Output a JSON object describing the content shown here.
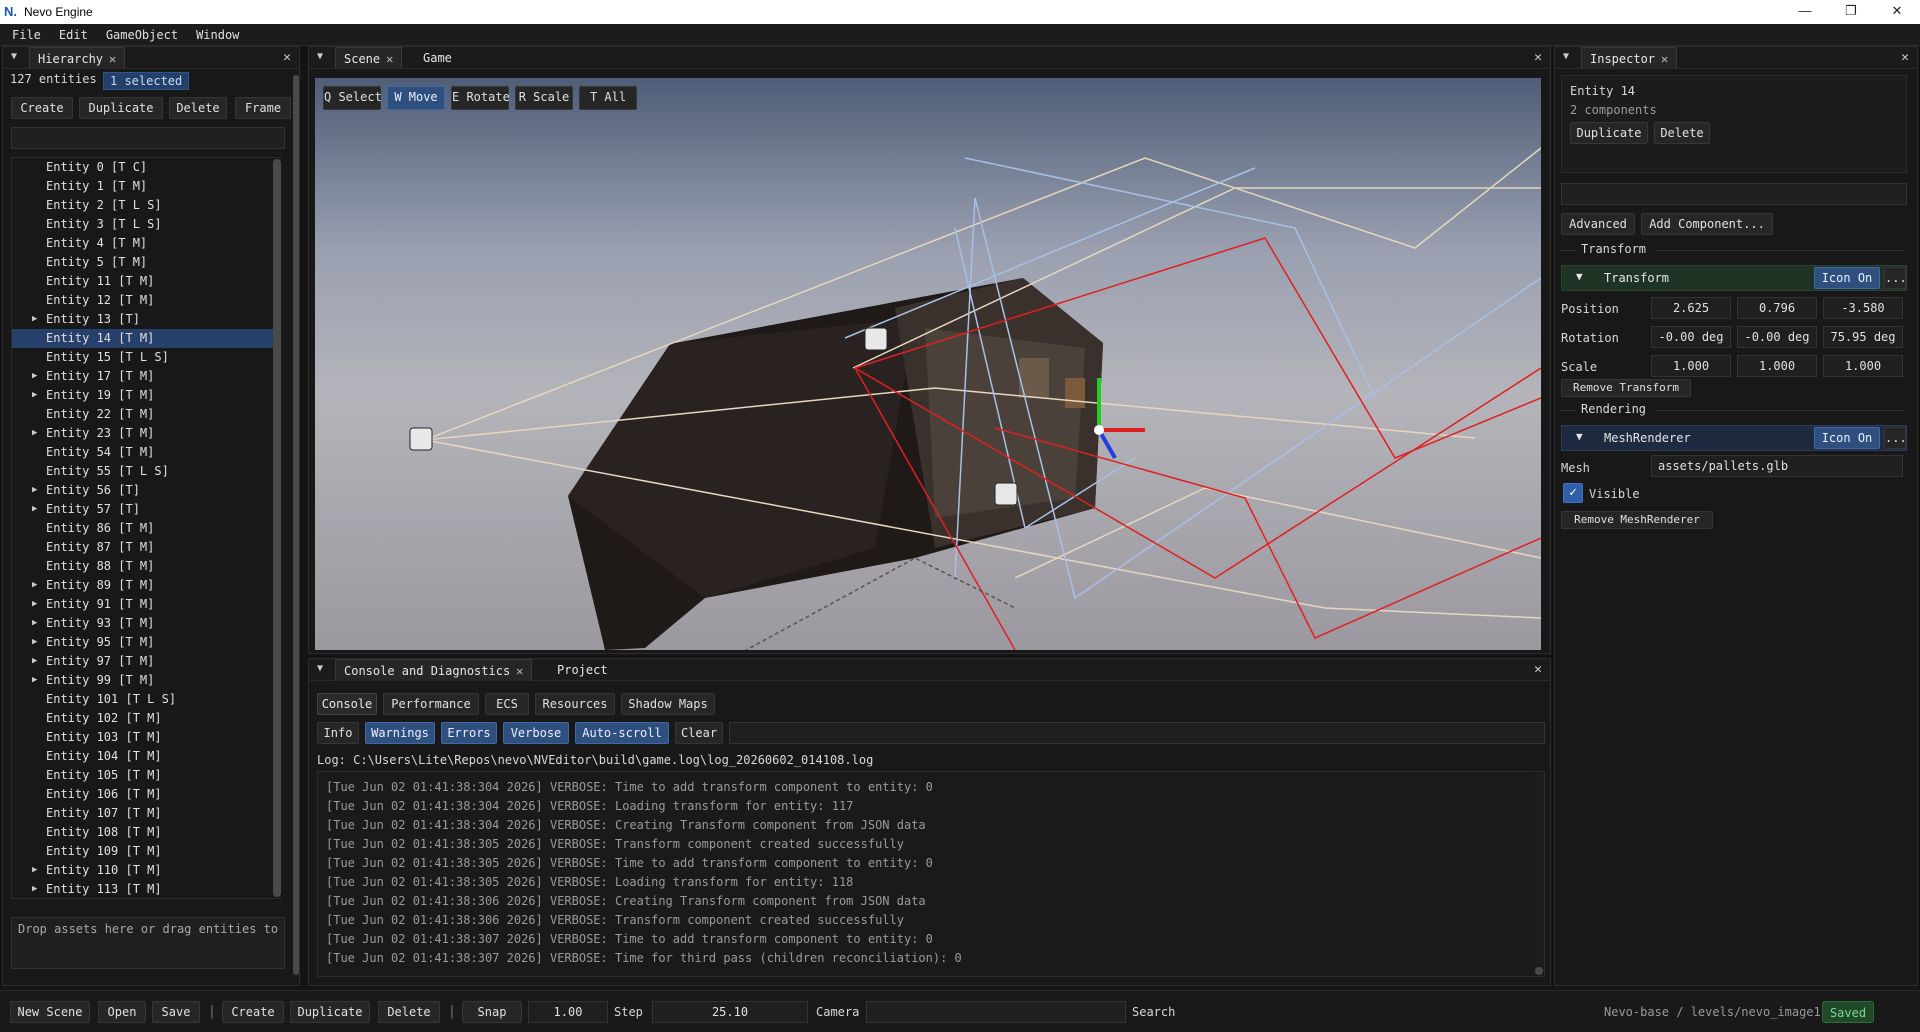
{
  "window": {
    "title": "Nevo Engine",
    "logo": "N.",
    "minimize": "—",
    "maximize": "❐",
    "close": "✕"
  },
  "menu": [
    "File",
    "Edit",
    "GameObject",
    "Window"
  ],
  "hierarchy": {
    "tab": "Hierarchy",
    "count": "127 entities",
    "selected_badge": "1 selected",
    "buttons": [
      "Create",
      "Duplicate",
      "Delete",
      "Frame"
    ],
    "filter_value": "",
    "entities": [
      {
        "label": "Entity 0 [T C]",
        "expandable": false,
        "selected": false
      },
      {
        "label": "Entity 1 [T M]",
        "expandable": false,
        "selected": false
      },
      {
        "label": "Entity 2 [T L S]",
        "expandable": false,
        "selected": false
      },
      {
        "label": "Entity 3 [T L S]",
        "expandable": false,
        "selected": false
      },
      {
        "label": "Entity 4 [T M]",
        "expandable": false,
        "selected": false
      },
      {
        "label": "Entity 5 [T M]",
        "expandable": false,
        "selected": false
      },
      {
        "label": "Entity 11 [T M]",
        "expandable": false,
        "selected": false
      },
      {
        "label": "Entity 12 [T M]",
        "expandable": false,
        "selected": false
      },
      {
        "label": "Entity 13 [T]",
        "expandable": true,
        "selected": false
      },
      {
        "label": "Entity 14 [T M]",
        "expandable": false,
        "selected": true
      },
      {
        "label": "Entity 15 [T L S]",
        "expandable": false,
        "selected": false
      },
      {
        "label": "Entity 17 [T M]",
        "expandable": true,
        "selected": false
      },
      {
        "label": "Entity 19 [T M]",
        "expandable": true,
        "selected": false
      },
      {
        "label": "Entity 22 [T M]",
        "expandable": false,
        "selected": false
      },
      {
        "label": "Entity 23 [T M]",
        "expandable": true,
        "selected": false
      },
      {
        "label": "Entity 54 [T M]",
        "expandable": false,
        "selected": false
      },
      {
        "label": "Entity 55 [T L S]",
        "expandable": false,
        "selected": false
      },
      {
        "label": "Entity 56 [T]",
        "expandable": true,
        "selected": false
      },
      {
        "label": "Entity 57 [T]",
        "expandable": true,
        "selected": false
      },
      {
        "label": "Entity 86 [T M]",
        "expandable": false,
        "selected": false
      },
      {
        "label": "Entity 87 [T M]",
        "expandable": false,
        "selected": false
      },
      {
        "label": "Entity 88 [T M]",
        "expandable": false,
        "selected": false
      },
      {
        "label": "Entity 89 [T M]",
        "expandable": true,
        "selected": false
      },
      {
        "label": "Entity 91 [T M]",
        "expandable": true,
        "selected": false
      },
      {
        "label": "Entity 93 [T M]",
        "expandable": true,
        "selected": false
      },
      {
        "label": "Entity 95 [T M]",
        "expandable": true,
        "selected": false
      },
      {
        "label": "Entity 97 [T M]",
        "expandable": true,
        "selected": false
      },
      {
        "label": "Entity 99 [T M]",
        "expandable": true,
        "selected": false
      },
      {
        "label": "Entity 101 [T L S]",
        "expandable": false,
        "selected": false
      },
      {
        "label": "Entity 102 [T M]",
        "expandable": false,
        "selected": false
      },
      {
        "label": "Entity 103 [T M]",
        "expandable": false,
        "selected": false
      },
      {
        "label": "Entity 104 [T M]",
        "expandable": false,
        "selected": false
      },
      {
        "label": "Entity 105 [T M]",
        "expandable": false,
        "selected": false
      },
      {
        "label": "Entity 106 [T M]",
        "expandable": false,
        "selected": false
      },
      {
        "label": "Entity 107 [T M]",
        "expandable": false,
        "selected": false
      },
      {
        "label": "Entity 108 [T M]",
        "expandable": false,
        "selected": false
      },
      {
        "label": "Entity 109 [T M]",
        "expandable": false,
        "selected": false
      },
      {
        "label": "Entity 110 [T M]",
        "expandable": true,
        "selected": false
      },
      {
        "label": "Entity 113 [T M]",
        "expandable": true,
        "selected": false
      }
    ],
    "drop_hint": "Drop assets here or drag entities to r"
  },
  "scene": {
    "tabs": [
      "Scene",
      "Game"
    ],
    "tools": [
      {
        "label": "Q Select",
        "active": false
      },
      {
        "label": "W Move",
        "active": true
      },
      {
        "label": "E Rotate",
        "active": false
      },
      {
        "label": "R Scale",
        "active": false
      },
      {
        "label": "T All",
        "active": false
      }
    ]
  },
  "console": {
    "tabs": [
      "Console and Diagnostics",
      "Project"
    ],
    "subtabs": [
      "Console",
      "Performance",
      "ECS",
      "Resources",
      "Shadow Maps"
    ],
    "filters": [
      {
        "label": "Info",
        "active": false
      },
      {
        "label": "Warnings",
        "active": true
      },
      {
        "label": "Errors",
        "active": true
      },
      {
        "label": "Verbose",
        "active": true
      },
      {
        "label": "Auto-scroll",
        "active": true
      },
      {
        "label": "Clear",
        "active": false
      }
    ],
    "log_path": "Log: C:\\Users\\Lite\\Repos\\nevo\\NVEditor\\build\\game.log\\log_20260602_014108.log",
    "lines": [
      "[Tue Jun 02 01:41:38:304 2026] VERBOSE: Time to add transform component to entity: 0",
      "[Tue Jun 02 01:41:38:304 2026] VERBOSE: Loading transform for entity: 117",
      "[Tue Jun 02 01:41:38:304 2026] VERBOSE: Creating Transform component from JSON data",
      "[Tue Jun 02 01:41:38:305 2026] VERBOSE: Transform component created successfully",
      "[Tue Jun 02 01:41:38:305 2026] VERBOSE: Time to add transform component to entity: 0",
      "[Tue Jun 02 01:41:38:305 2026] VERBOSE: Loading transform for entity: 118",
      "[Tue Jun 02 01:41:38:306 2026] VERBOSE: Creating Transform component from JSON data",
      "[Tue Jun 02 01:41:38:306 2026] VERBOSE: Transform component created successfully",
      "[Tue Jun 02 01:41:38:307 2026] VERBOSE: Time to add transform component to entity: 0",
      "[Tue Jun 02 01:41:38:307 2026] VERBOSE: Time for third pass (children reconciliation): 0"
    ]
  },
  "inspector": {
    "tab": "Inspector",
    "entity_name": "Entity 14",
    "components_count": "2 components",
    "duplicate": "Duplicate",
    "delete": "Delete",
    "advanced": "Advanced",
    "add_component": "Add Component...",
    "transform_header": "Transform",
    "transform_section": "Transform",
    "icon_on": "Icon On",
    "more": "...",
    "position_label": "Position",
    "position": [
      "2.625",
      "0.796",
      "-3.580"
    ],
    "rotation_label": "Rotation",
    "rotation": [
      "-0.00 deg",
      "-0.00 deg",
      "75.95 deg"
    ],
    "scale_label": "Scale",
    "scale": [
      "1.000",
      "1.000",
      "1.000"
    ],
    "remove_transform": "Remove Transform",
    "rendering_header": "Rendering",
    "meshrenderer_section": "MeshRenderer",
    "mesh_label": "Mesh",
    "mesh_value": "assets/pallets.glb",
    "visible_label": "Visible",
    "visible": true,
    "remove_meshrenderer": "Remove MeshRenderer"
  },
  "statusbar": {
    "new_scene": "New Scene",
    "open": "Open",
    "save": "Save",
    "create": "Create",
    "duplicate": "Duplicate",
    "delete": "Delete",
    "snap": "Snap",
    "snap_value": "1.00",
    "step_label": "Step",
    "step_value": "25.10",
    "camera_label": "Camera",
    "camera_value": "",
    "search_label": "Search",
    "path": "Nevo-base / levels/nevo_image1",
    "saved": "Saved"
  }
}
